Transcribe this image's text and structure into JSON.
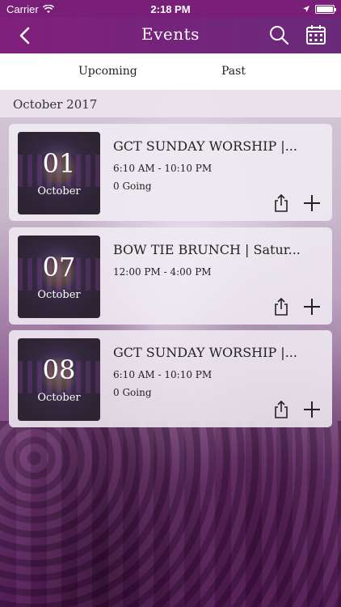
{
  "status_bar": {
    "carrier": "Carrier",
    "time": "2:18 PM"
  },
  "nav": {
    "title": "Events",
    "icons": [
      "back-chevron-icon",
      "search-icon",
      "calendar-icon"
    ]
  },
  "tabs": {
    "upcoming": "Upcoming",
    "past": "Past"
  },
  "month_header": "October 2017",
  "events": [
    {
      "day": "01",
      "month": "October",
      "title": "GCT SUNDAY WORSHIP |...",
      "time": "6:10 AM - 10:10 PM",
      "going": "0 Going"
    },
    {
      "day": "07",
      "month": "October",
      "title": "BOW TIE BRUNCH | Satur...",
      "time": "12:00 PM - 4:00 PM",
      "going": ""
    },
    {
      "day": "08",
      "month": "October",
      "title": "GCT SUNDAY WORSHIP |...",
      "time": "6:10 AM - 10:10 PM",
      "going": "0 Going"
    }
  ],
  "colors": {
    "nav_bar": "#7a1f78",
    "accent": "#801f7c"
  }
}
